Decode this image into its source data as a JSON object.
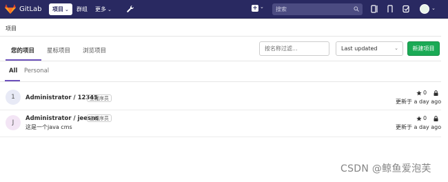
{
  "navbar": {
    "brand": "GitLab",
    "items": [
      {
        "label": "项目"
      },
      {
        "label": "群组"
      },
      {
        "label": "更多"
      }
    ],
    "search_placeholder": "搜索"
  },
  "breadcrumb": "项目",
  "tabs": [
    {
      "label": "您的项目"
    },
    {
      "label": "星标项目"
    },
    {
      "label": "浏览项目"
    }
  ],
  "filter": {
    "placeholder": "按名称过滤..."
  },
  "sort": {
    "value": "Last updated"
  },
  "new_project_label": "新建项目",
  "subtabs": [
    {
      "label": "All"
    },
    {
      "label": "Personal"
    }
  ],
  "projects": [
    {
      "initial": "1",
      "name": "Administrator / 12345",
      "role": "主程序员",
      "description": "",
      "stars": "0",
      "updated": "更新于 a day ago",
      "avatar_color": "#e8eaf6"
    },
    {
      "initial": "J",
      "name": "Administrator / jeesns",
      "role": "主程序员",
      "description": "这是一个java cms",
      "stars": "0",
      "updated": "更新于 a day ago",
      "avatar_color": "#f3e5f5"
    }
  ],
  "watermark": "CSDN @鲸鱼爱泡芙",
  "colors": {
    "navbar": "#292961",
    "accent": "#6b4fbb",
    "primary_button": "#1aaa55"
  }
}
